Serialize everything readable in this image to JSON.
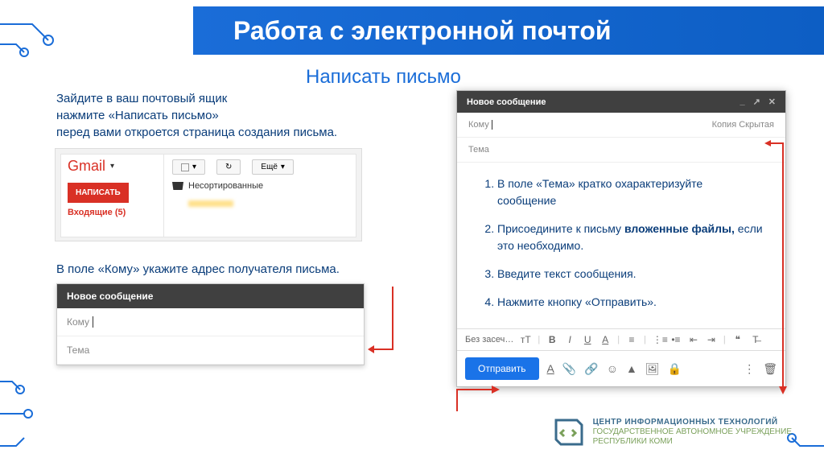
{
  "title": "Работа с электронной почтой",
  "subtitle": "Написать письмо",
  "intro": {
    "line1": "Зайдите в ваш почтовый ящик",
    "line2": "нажмите «Написать письмо»",
    "line3": "перед вами откроется страница создания письма."
  },
  "gmail": {
    "logo": "Gmail",
    "compose": "НАПИСАТЬ",
    "inbox": "Входящие (5)",
    "refresh_icon": "↻",
    "more": "Ещё",
    "unsorted": "Несортированные"
  },
  "instr2": "В поле «Кому» укажите адрес получателя письма.",
  "compose1": {
    "title": "Новое сообщение",
    "to": "Кому",
    "subject": "Тема"
  },
  "compose2": {
    "title": "Новое сообщение",
    "to": "Кому",
    "cc": "Копия Скрытая",
    "subject": "Тема",
    "steps": [
      "В поле «Тема» кратко охарактеризуйте сообщение",
      "Присоедините к письму <b>вложенные файлы,</b> если это необходимо.",
      "Введите текст сообщения.",
      "Нажмите кнопку «Отправить»."
    ],
    "font": "Без засеч…",
    "send": "Отправить"
  },
  "footer": {
    "line1": "ЦЕНТР ИНФОРМАЦИОННЫХ ТЕХНОЛОГИЙ",
    "line2": "ГОСУДАРСТВЕННОЕ АВТОНОМНОЕ УЧРЕЖДЕНИЕ",
    "line3": "РЕСПУБЛИКИ КОМИ"
  }
}
